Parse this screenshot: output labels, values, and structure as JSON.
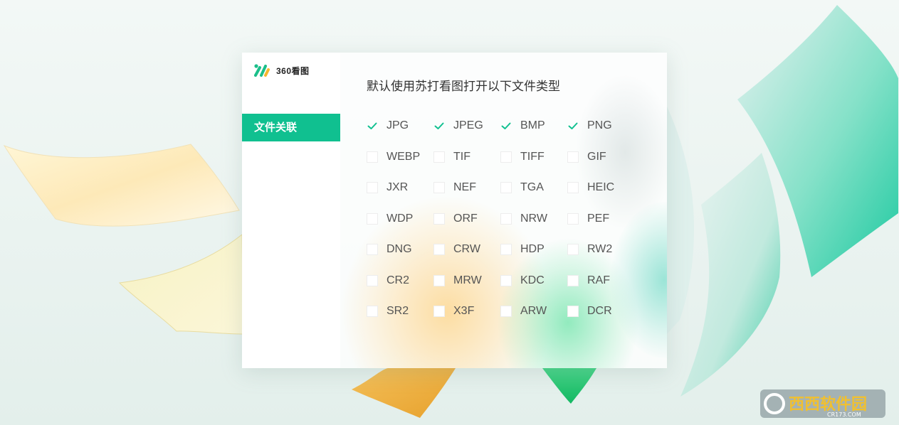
{
  "app": {
    "name": "360看图",
    "accent": "#10c090"
  },
  "sidebar": {
    "items": [
      {
        "label": "文件关联",
        "selected": true
      }
    ]
  },
  "main": {
    "heading": "默认使用苏打看图打开以下文件类型",
    "formats": [
      {
        "label": "JPG",
        "checked": true
      },
      {
        "label": "JPEG",
        "checked": true
      },
      {
        "label": "BMP",
        "checked": true
      },
      {
        "label": "PNG",
        "checked": true
      },
      {
        "label": "WEBP",
        "checked": false
      },
      {
        "label": "TIF",
        "checked": false
      },
      {
        "label": "TIFF",
        "checked": false
      },
      {
        "label": "GIF",
        "checked": false
      },
      {
        "label": "JXR",
        "checked": false
      },
      {
        "label": "NEF",
        "checked": false
      },
      {
        "label": "TGA",
        "checked": false
      },
      {
        "label": "HEIC",
        "checked": false
      },
      {
        "label": "WDP",
        "checked": false
      },
      {
        "label": "ORF",
        "checked": false
      },
      {
        "label": "NRW",
        "checked": false
      },
      {
        "label": "PEF",
        "checked": false
      },
      {
        "label": "DNG",
        "checked": false
      },
      {
        "label": "CRW",
        "checked": false
      },
      {
        "label": "HDP",
        "checked": false
      },
      {
        "label": "RW2",
        "checked": false
      },
      {
        "label": "CR2",
        "checked": false
      },
      {
        "label": "MRW",
        "checked": false
      },
      {
        "label": "KDC",
        "checked": false
      },
      {
        "label": "RAF",
        "checked": false
      },
      {
        "label": "SR2",
        "checked": false
      },
      {
        "label": "X3F",
        "checked": false
      },
      {
        "label": "ARW",
        "checked": false
      },
      {
        "label": "DCR",
        "checked": false
      }
    ]
  },
  "watermark": {
    "text": "西西软件园",
    "subtext": "CR173.COM"
  }
}
